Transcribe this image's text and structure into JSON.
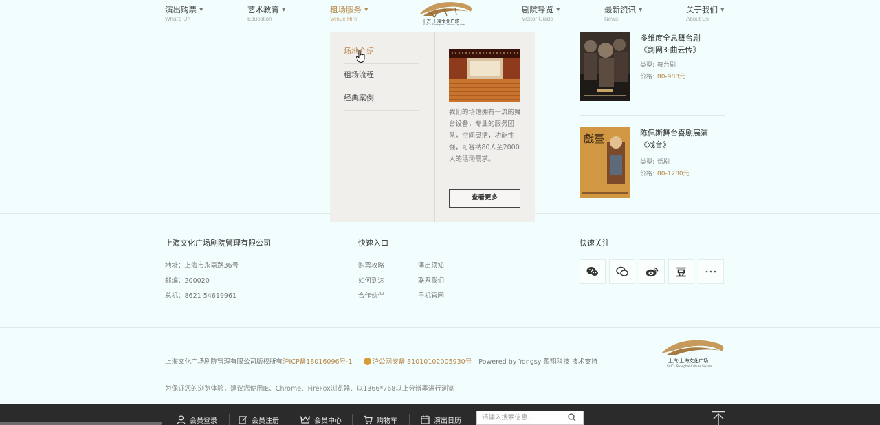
{
  "nav": {
    "items": [
      {
        "cn": "演出购票",
        "en": "What's On"
      },
      {
        "cn": "艺术教育",
        "en": "Education"
      },
      {
        "cn": "租场服务",
        "en": "Venue Hire"
      },
      {
        "cn": "剧院导览",
        "en": "Visitor Guide"
      },
      {
        "cn": "最新资讯",
        "en": "News"
      },
      {
        "cn": "关于我们",
        "en": "About Us"
      }
    ],
    "active_index": 2,
    "logo_text": "上汽·上海文化广场",
    "logo_subtext": "SAIC · Shanghai Culture Square"
  },
  "dropdown": {
    "menu": [
      "场地介绍",
      "租场流程",
      "经典案例"
    ],
    "active_index": 0,
    "description": "我们的场馆拥有一流的舞台设备，专业的服务团队，空间灵活，功能性强，可容纳80人至2000人的活动需求。",
    "more_label": "查看更多"
  },
  "shows": [
    {
      "title_line1": "多维度全息舞台剧",
      "title_line2": "《剑网3·曲云传》",
      "type_label": "类型:",
      "type_value": "舞台剧",
      "price_label": "价格:",
      "price_value": "80-988元"
    },
    {
      "title_line1": "陈佩斯舞台喜剧展演",
      "title_line2": "《戏台》",
      "type_label": "类型:",
      "type_value": "话剧",
      "price_label": "价格:",
      "price_value": "80-1280元",
      "poster_text": "戲臺"
    }
  ],
  "footer": {
    "company": "上海文化广场剧院管理有限公司",
    "address": "地址：上海市永嘉路36号",
    "postcode": "邮编：200020",
    "phone": "总机：8621 54619961",
    "quick_title": "快速入口",
    "quick_links": [
      "购票攻略",
      "演出须知",
      "如何到达",
      "联系我们",
      "合作伙伴",
      "手机官网"
    ],
    "follow_title": "快速关注",
    "social_icons": [
      "wechat-icon",
      "chat-icon",
      "weibo-icon",
      "douban-icon",
      "more-icon"
    ],
    "social_douban_glyph": "豆",
    "copyright_prefix": "上海文化广场剧院管理有限公司版权所有",
    "icp": "沪ICP备18016096号-1",
    "police": "沪公网安备 31010102005930号",
    "powered": "Powered by Yongsy 盈翔科技 技术支持",
    "browser_tip": "为保证您的浏览体验，建议您使用IE、Chrome、FireFox浏览器、以1366*768以上分辨率进行浏览"
  },
  "bottombar": {
    "items": [
      "会员登录",
      "会员注册",
      "会员中心",
      "购物车",
      "演出日历"
    ],
    "search_placeholder": "请输入搜索信息..."
  },
  "colors": {
    "accent": "#b8884a",
    "background": "#f2fefd",
    "dropdown_bg": "#f1efec",
    "bottombar": "#2b2b2b"
  }
}
